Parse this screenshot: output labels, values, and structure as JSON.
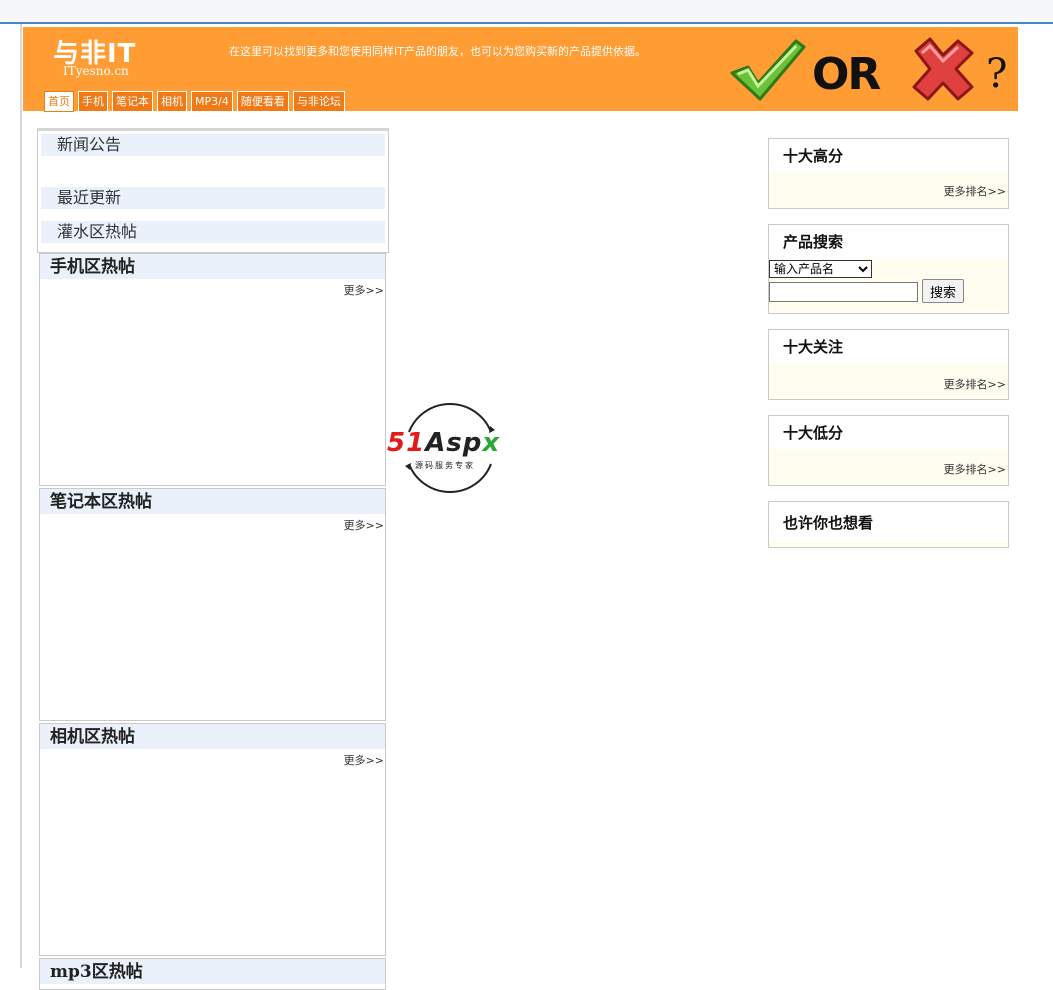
{
  "header": {
    "logo_main": "与非IT",
    "logo_sub": "ITyesno.cn",
    "tagline": "在这里可以找到更多和您使用同样IT产品的朋友，也可以为您购买新的产品提供依据。",
    "or_text": "OR",
    "question": "?"
  },
  "nav": [
    "首页",
    "手机",
    "笔记本",
    "相机",
    "MP3/4",
    "随便看看",
    "与非论坛"
  ],
  "news": {
    "announcements": "新闻公告",
    "recent": "最近更新",
    "water_hot": "灌水区热帖"
  },
  "panels": {
    "phone": {
      "title": "手机区热帖",
      "more": "更多>>"
    },
    "laptop": {
      "title": "笔记本区热帖",
      "more": "更多>>"
    },
    "camera": {
      "title": "相机区热帖",
      "more": "更多>>"
    },
    "mp3": {
      "title": "mp3区热帖"
    }
  },
  "sidebar": {
    "top_rated": {
      "title": "十大高分",
      "more": "更多排名>>"
    },
    "search": {
      "title": "产品搜索",
      "select_value": "输入产品名",
      "button": "搜索"
    },
    "top_followed": {
      "title": "十大关注",
      "more": "更多排名>>"
    },
    "lowest_rated": {
      "title": "十大低分",
      "more": "更多排名>>"
    },
    "maybe_like": {
      "title": "也许你也想看"
    }
  },
  "watermark": {
    "brand": "51Aspx",
    "sub": "源码服务专家"
  },
  "colors": {
    "header_bg": "#ff9c33",
    "nav_bg": "#f07a16",
    "panel_title_bg": "#eaf1fb",
    "sidebar_body": "#fefdf0"
  }
}
